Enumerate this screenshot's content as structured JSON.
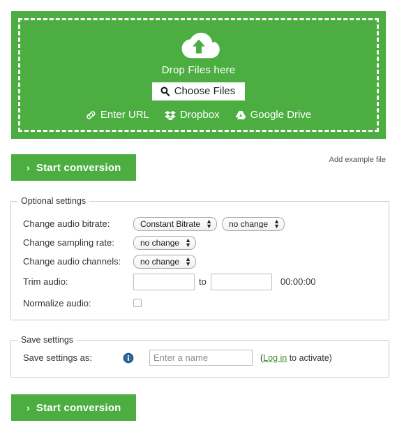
{
  "dropzone": {
    "icon": "cloud-upload-icon",
    "drop_label": "Drop Files here",
    "choose_files_label": "Choose Files",
    "choose_files_icon": "search-icon",
    "sources": [
      {
        "label": "Enter URL",
        "icon": "link-icon"
      },
      {
        "label": "Dropbox",
        "icon": "dropbox-icon"
      },
      {
        "label": "Google Drive",
        "icon": "google-drive-icon"
      }
    ],
    "background_color": "#4cae41",
    "border_color": "#ffffff"
  },
  "actions": {
    "start_conversion_top": "Start conversion",
    "start_conversion_bottom": "Start conversion",
    "chevron": "›",
    "add_example_file": "Add example file",
    "button_color": "#4cae41"
  },
  "optional_settings": {
    "legend": "Optional settings",
    "rows": [
      {
        "label": "Change audio bitrate:",
        "controls": [
          {
            "type": "select",
            "value": "Constant Bitrate",
            "name": "bitrate-mode-select"
          },
          {
            "type": "select",
            "value": "no change",
            "name": "bitrate-value-select"
          }
        ]
      },
      {
        "label": "Change sampling rate:",
        "controls": [
          {
            "type": "select",
            "value": "no change",
            "name": "sampling-rate-select"
          }
        ]
      },
      {
        "label": "Change audio channels:",
        "controls": [
          {
            "type": "select",
            "value": "no change",
            "name": "audio-channels-select"
          }
        ]
      },
      {
        "label": "Trim audio:",
        "controls": [
          {
            "type": "text",
            "value": "",
            "name": "trim-start-input"
          },
          {
            "type": "word",
            "value": "to"
          },
          {
            "type": "text",
            "value": "",
            "name": "trim-end-input"
          },
          {
            "type": "static",
            "value": "00:00:00"
          }
        ]
      },
      {
        "label": "Normalize audio:",
        "controls": [
          {
            "type": "checkbox",
            "checked": false,
            "name": "normalize-audio-checkbox"
          }
        ]
      }
    ],
    "trim": {
      "start_value": "",
      "end_value": "",
      "separator": "to",
      "duration": "00:00:00"
    }
  },
  "save_settings": {
    "legend": "Save settings",
    "label": "Save settings as:",
    "info_icon": "info-icon",
    "name_placeholder": "Enter a name",
    "name_value": "",
    "note_prefix": "(",
    "login_link": "Log in",
    "note_suffix": " to activate)",
    "link_color": "#3c8c27"
  }
}
